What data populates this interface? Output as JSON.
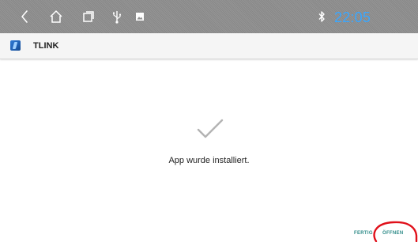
{
  "status_bar": {
    "icons": [
      "back-icon",
      "home-icon",
      "recents-icon",
      "usb-icon",
      "image-icon",
      "bluetooth-icon"
    ],
    "time": "22:05",
    "colors": {
      "background": "#8f8f8f",
      "time": "#3aa7ff"
    }
  },
  "app_bar": {
    "title": "TLINK",
    "icon": "tlink-app-icon"
  },
  "main": {
    "icon": "checkmark-icon",
    "message": "App wurde installiert."
  },
  "actions": {
    "done_label": "FERTIG",
    "open_label": "ÖFFNEN",
    "accent_color": "#2e8b88"
  },
  "annotation": {
    "type": "red-circle-highlight",
    "target": "open-button",
    "color": "#e0101a"
  }
}
